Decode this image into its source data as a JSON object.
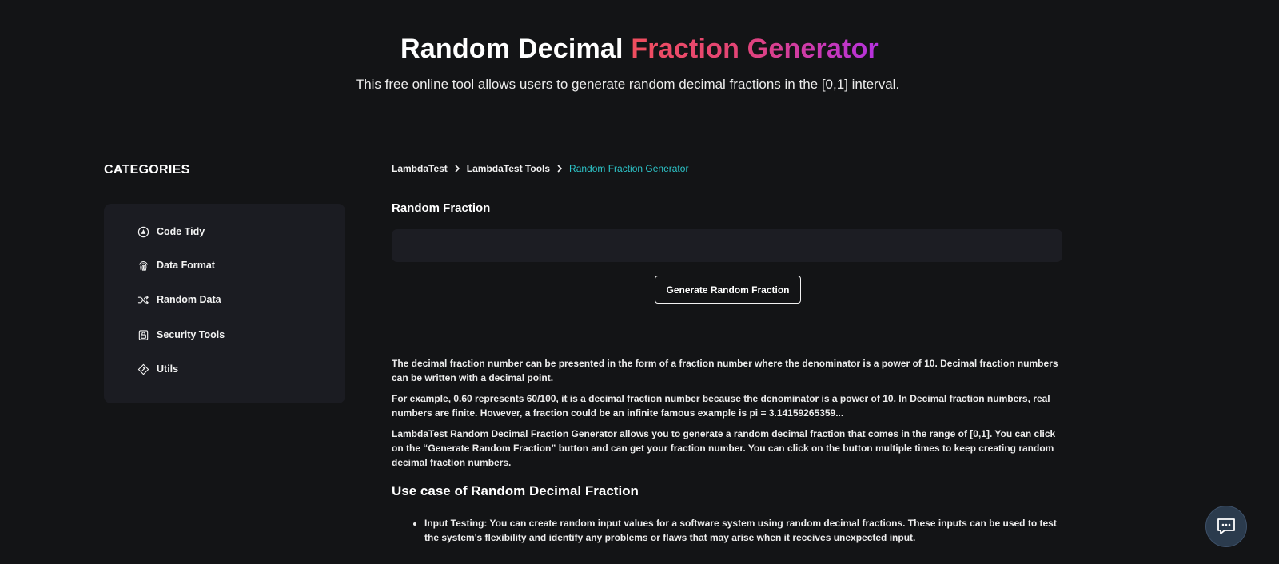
{
  "hero": {
    "title_main": "Random Decimal ",
    "title_accent": "Fraction Generator",
    "subtitle": "This free online tool allows users to generate random decimal fractions in the [0,1] interval."
  },
  "sidebar": {
    "title": "CATEGORIES",
    "items": [
      {
        "label": "Code Tidy",
        "icon": "code-tidy-icon"
      },
      {
        "label": "Data Format",
        "icon": "fingerprint-icon"
      },
      {
        "label": "Random Data",
        "icon": "shuffle-icon"
      },
      {
        "label": "Security Tools",
        "icon": "lock-icon"
      },
      {
        "label": "Utils",
        "icon": "utils-icon"
      }
    ]
  },
  "breadcrumb": {
    "items": [
      "LambdaTest",
      "LambdaTest Tools"
    ],
    "current": "Random Fraction Generator"
  },
  "tool": {
    "label": "Random Fraction",
    "output_value": "",
    "button_label": "Generate Random Fraction"
  },
  "content": {
    "paragraphs": [
      "The decimal fraction number can be presented in the form of a fraction number where the denominator is a power of 10. Decimal fraction numbers can be written with a decimal point.",
      "For example, 0.60 represents 60/100, it is a decimal fraction number because the denominator is a power of 10. In Decimal fraction numbers, real numbers are finite. However, a fraction could be an infinite famous example is pi = 3.14159265359...",
      "LambdaTest Random Decimal Fraction Generator allows you to generate a random decimal fraction that comes in the range of [0,1]. You can click on the “Generate Random Fraction” button and can get your fraction number. You can click on the button multiple times to keep creating random decimal fraction numbers."
    ],
    "heading": "Use case of Random Decimal Fraction",
    "list": [
      "Input Testing: You can create random input values for a software system using random decimal fractions. These inputs can be used to test the system's flexibility and identify any problems or flaws that may arise when it receives unexpected input."
    ]
  },
  "chat": {
    "icon": "chat-icon"
  }
}
